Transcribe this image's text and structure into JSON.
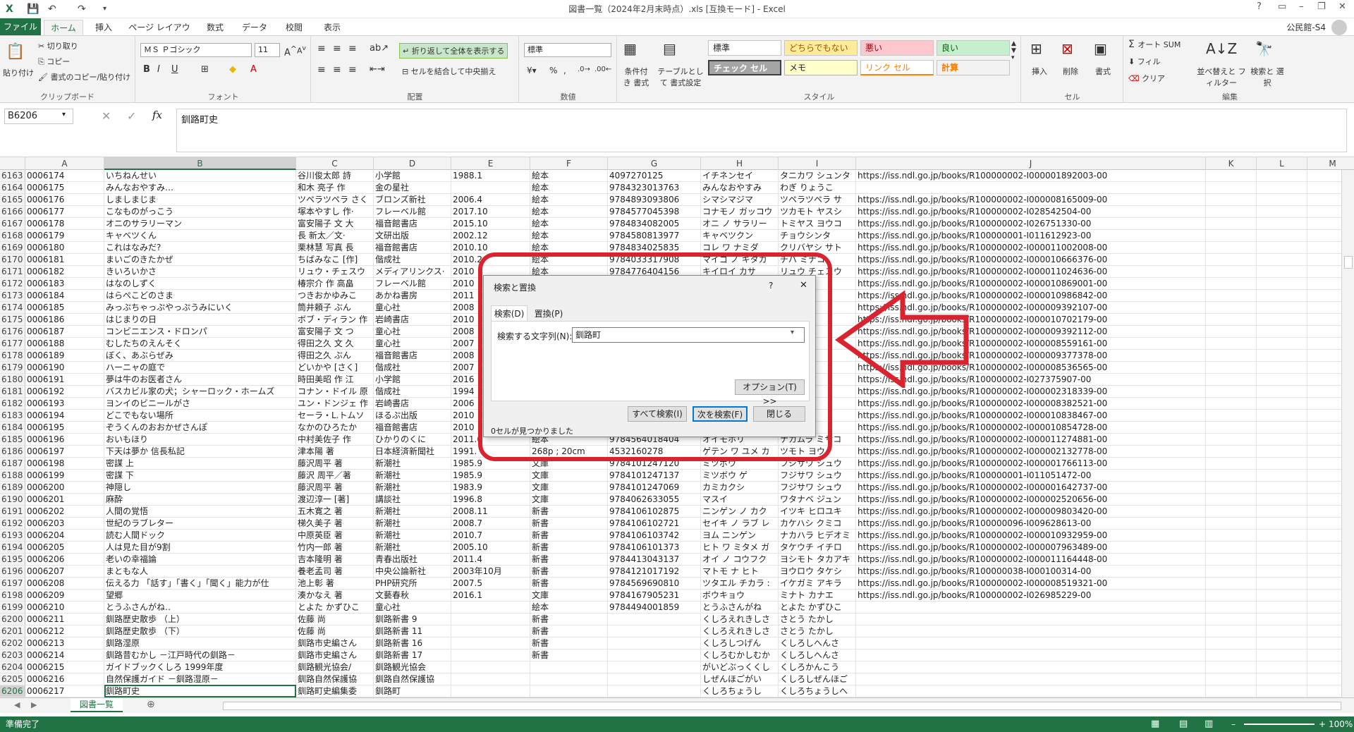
{
  "window": {
    "title": "図書一覧（2024年2月末時点）.xls  [互換モード] - Excel",
    "account": "公民館-S4"
  },
  "tabs": [
    "ファイル",
    "ホーム",
    "挿入",
    "ページ レイアウト",
    "数式",
    "データ",
    "校閲",
    "表示"
  ],
  "ribbon": {
    "clipboard": {
      "paste": "貼り付け",
      "cut": "切り取り",
      "copy": "コピー",
      "format_painter": "書式のコピー/貼り付け",
      "label": "クリップボード"
    },
    "font": {
      "name": "ＭＳ Ｐゴシック",
      "size": "11",
      "label": "フォント"
    },
    "alignment": {
      "wrap": "折り返して全体を表示する",
      "merge": "セルを結合して中央揃え",
      "label": "配置"
    },
    "number": {
      "format": "標準",
      "label": "数値"
    },
    "styles": {
      "conditional": "条件付き 書式",
      "table": "テーブルとして 書式設定",
      "cells": [
        "標準",
        "どちらでもない",
        "悪い",
        "良い",
        "チェック セル",
        "メモ",
        "リンク セル",
        "計算"
      ],
      "label": "スタイル"
    },
    "cells": {
      "insert": "挿入",
      "delete": "削除",
      "format": "書式",
      "label": "セル"
    },
    "editing": {
      "autosum": "オート SUM",
      "fill": "フィル",
      "clear": "クリア",
      "sort": "並べ替えと フィルター",
      "find": "検索と 選択",
      "label": "編集"
    }
  },
  "formula_bar": {
    "name_box": "B6206",
    "formula": "釧路町史",
    "fx": "fx"
  },
  "columns": [
    "A",
    "B",
    "C",
    "D",
    "E",
    "F",
    "G",
    "H",
    "I",
    "J",
    "K",
    "L",
    "M"
  ],
  "rows": [
    [
      "6163",
      "0006174",
      "いちねんせい",
      "谷川俊太郎 詩",
      "小学館",
      "1988.1",
      "絵本",
      "4097270125",
      "イチネンセイ",
      "タニカワ シュンタ",
      "https://iss.ndl.go.jp/books/R100000002-I000001892003-00"
    ],
    [
      "6164",
      "0006175",
      "みんなおやすみ…",
      "和木 亮子 作",
      "金の星社",
      "",
      "絵本",
      "9784323013763",
      "みんなおやすみ",
      "わぎ りょうこ",
      ""
    ],
    [
      "6165",
      "0006176",
      "しましまじま",
      "ツペラツペラ さく",
      "ブロンズ新社",
      "2006.4",
      "絵本",
      "9784893093806",
      "シマシマジマ",
      "ツペラツペラ サ",
      "https://iss.ndl.go.jp/books/R100000002-I000008165009-00"
    ],
    [
      "6166",
      "0006177",
      "こなものがっこう",
      "塚本やすし 作·",
      "フレーベル館",
      "2017.10",
      "絵本",
      "9784577045398",
      "コナモノ ガッコウ",
      "ツカモト ヤスシ",
      "https://iss.ndl.go.jp/books/R100000002-I028542504-00"
    ],
    [
      "6167",
      "0006178",
      "オニのサラリーマン",
      "富安陽子 文 大",
      "福音館書店",
      "2015.10",
      "絵本",
      "9784834082005",
      "オニ ノ サラリー",
      "トミヤス ヨウコ",
      "https://iss.ndl.go.jp/books/R100000002-I026751330-00"
    ],
    [
      "6168",
      "0006179",
      "キャベツくん",
      "長 新太／文·",
      "文研出版",
      "2002.12",
      "絵本",
      "9784580813977",
      "キャベツクン",
      "チョウシンタ",
      "https://iss.ndl.go.jp/books/R100000001-I011612923-00"
    ],
    [
      "6169",
      "0006180",
      "これはなみだ?",
      "栗林慧 写真 長",
      "福音館書店",
      "2010.10",
      "絵本",
      "9784834025835",
      "コレ ワ ナミダ",
      "クリバヤシ サト",
      "https://iss.ndl.go.jp/books/R100000002-I000011002008-00"
    ],
    [
      "6170",
      "0006181",
      "まいごのきたかぜ",
      "ちばみなこ [作]",
      "偕成社",
      "2010.2",
      "絵本",
      "9784033317908",
      "マイゴ ノ キタカ",
      "チバ ミナコ",
      "https://iss.ndl.go.jp/books/R100000002-I000010666376-00"
    ],
    [
      "6171",
      "0006182",
      "きいろいかさ",
      "リュウ・チェスウ",
      "メディアリンクス·",
      "2010",
      "絵本",
      "9784776404156",
      "キイロイ カサ",
      "リュウ チェスウ",
      "https://iss.ndl.go.jp/books/R100000002-I000011024636-00"
    ],
    [
      "6172",
      "0006183",
      "はなのしずく",
      "椿宗介 作 高畠",
      "フレーベル館",
      "2010",
      "",
      "",
      "",
      "",
      "https://iss.ndl.go.jp/books/R100000002-I000010869001-00"
    ],
    [
      "6173",
      "0006184",
      "はらぺこどのさま",
      "つきおかゆみこ",
      "あかね書房",
      "2011",
      "",
      "",
      "",
      "",
      "https://iss.ndl.go.jp/books/R100000002-I000010986842-00"
    ],
    [
      "6174",
      "0006185",
      "みっぷちゃっぷやっぷうみにいく",
      "筒井頼子 ぶん",
      "童心社",
      "2008",
      "",
      "",
      "",
      "",
      "https://iss.ndl.go.jp/books/R100000002-I000009392107-00"
    ],
    [
      "6175",
      "0006186",
      "はじまりの日",
      "ボブ・ディラン 作",
      "岩崎書店",
      "2010",
      "",
      "",
      "",
      "",
      "https://iss.ndl.go.jp/books/R100000002-I000010702179-00"
    ],
    [
      "6176",
      "0006187",
      "コンビニエンス・ドロンパ",
      "富安陽子 文 つ",
      "童心社",
      "2008",
      "",
      "",
      "",
      "",
      "https://iss.ndl.go.jp/books/R100000002-I000009392112-00"
    ],
    [
      "6177",
      "0006188",
      "むしたちのえんそく",
      "得田之久 文 久",
      "童心社",
      "2007",
      "",
      "",
      "",
      "",
      "https://iss.ndl.go.jp/books/R100000002-I000008559161-00"
    ],
    [
      "6178",
      "0006189",
      "ぼく、あぶらぜみ",
      "得田之久 ぶん",
      "福音館書店",
      "2008",
      "",
      "",
      "",
      "",
      "https://iss.ndl.go.jp/books/R100000002-I000009377378-00"
    ],
    [
      "6179",
      "0006190",
      "ハーニャの庭で",
      "どいかや [さく]",
      "偕成社",
      "2007",
      "",
      "",
      "",
      "",
      "https://iss.ndl.go.jp/books/R100000002-I000008536565-00"
    ],
    [
      "6180",
      "0006191",
      "夢は牛のお医者さん",
      "時田美昭 作 江",
      "小学館",
      "2016",
      "",
      "",
      "",
      "",
      "https://iss.ndl.go.jp/books/R100000002-I027375907-00"
    ],
    [
      "6181",
      "0006192",
      "バスカビル家の犬；シャーロック・ホームズ",
      "コナン・ドイル 原",
      "偕成社",
      "1994",
      "",
      "",
      "",
      "",
      "https://iss.ndl.go.jp/books/R100000002-I000002318339-00"
    ],
    [
      "6182",
      "0006193",
      "ヨンイのビニールがさ",
      "ユン・ドンジェ 作",
      "岩崎書店",
      "2006",
      "",
      "",
      "",
      "",
      "https://iss.ndl.go.jp/books/R100000002-I000008382521-00"
    ],
    [
      "6183",
      "0006194",
      "どこでもない場所",
      "セーラ・L.トムソ",
      "ほるぷ出版",
      "2010",
      "",
      "",
      "",
      "",
      "https://iss.ndl.go.jp/books/R100000002-I000010838467-00"
    ],
    [
      "6184",
      "0006195",
      "ぞうくんのおおかぜさんぽ",
      "なかのひろたか",
      "福音館書店",
      "2010",
      "",
      "",
      "",
      "",
      "https://iss.ndl.go.jp/books/R100000002-I000010854728-00"
    ],
    [
      "6185",
      "0006196",
      "おいもほり",
      "中村美佐子 作",
      "ひかりのくに",
      "2011.0",
      "絵本",
      "9784564018404",
      "オイモホリ",
      "ナカムラ ミサコ",
      "https://iss.ndl.go.jp/books/R100000002-I000011274881-00"
    ],
    [
      "6186",
      "0006197",
      "下天は夢か 信長私記",
      "津本陽 著",
      "日本経済新聞社",
      "1991.",
      "268p ; 20cm",
      "4532160278",
      "ゲテン ワ ユメ カ",
      "ツモト ヨウ",
      "https://iss.ndl.go.jp/books/R100000002-I000002132778-00"
    ],
    [
      "6187",
      "0006198",
      "密謀 上",
      "藤沢周平 著",
      "新潮社",
      "1985.9",
      "文庫",
      "9784101247120",
      "ミツボウ",
      "フジサワ シュウ",
      "https://iss.ndl.go.jp/books/R100000002-I000001766113-00"
    ],
    [
      "6188",
      "0006199",
      "密謀 下",
      "藤沢 周平／著",
      "新潮社",
      "1985.9",
      "文庫",
      "9784101247137",
      "ミツボウ ゲ",
      "フジサワ シュウ",
      "https://iss.ndl.go.jp/books/R100000001-I011051472-00"
    ],
    [
      "6189",
      "0006200",
      "神隠し",
      "藤沢周平 著",
      "新潮社",
      "1983.9",
      "文庫",
      "9784101247069",
      "カミカクシ",
      "フジサワ シュウ",
      "https://iss.ndl.go.jp/books/R100000002-I000001642737-00"
    ],
    [
      "6190",
      "0006201",
      "麻酔",
      "渡辺淳一 [著]",
      "講談社",
      "1996.8",
      "文庫",
      "9784062633055",
      "マスイ",
      "ワタナベ ジュン",
      "https://iss.ndl.go.jp/books/R100000002-I000002520656-00"
    ],
    [
      "6191",
      "0006202",
      "人間の覚悟",
      "五木寛之 著",
      "新潮社",
      "2008.11",
      "新書",
      "9784106102875",
      "ニンゲン ノ カク",
      "イツキ ヒロユキ",
      "https://iss.ndl.go.jp/books/R100000002-I000009803420-00"
    ],
    [
      "6192",
      "0006203",
      "世紀のラブレター",
      "梯久美子 著",
      "新潮社",
      "2008.7",
      "新書",
      "9784106102721",
      "セイキ ノ ラブ レ",
      "カケハシ クミコ",
      "https://iss.ndl.go.jp/books/R100000096-I009628613-00"
    ],
    [
      "6193",
      "0006204",
      "読む人間ドック",
      "中原英臣 著",
      "新潮社",
      "2010.7",
      "新書",
      "9784106103742",
      "ヨム ニンゲン",
      "ナカハラ ヒデオミ",
      "https://iss.ndl.go.jp/books/R100000002-I000010932959-00"
    ],
    [
      "6194",
      "0006205",
      "人は見た目が9割",
      "竹内一郎 著",
      "新潮社",
      "2005.10",
      "新書",
      "9784106101373",
      "ヒト ワ ミタメ ガ",
      "タケウチ イチロ",
      "https://iss.ndl.go.jp/books/R100000002-I000007963489-00"
    ],
    [
      "6195",
      "0006206",
      "老いの幸福論",
      "吉本隆明 著",
      "青春出版社",
      "2011.4",
      "新書",
      "9784413043137",
      "オイ ノ コウフク",
      "ヨシモト タカアキ",
      "https://iss.ndl.go.jp/books/R100000002-I000011164448-00"
    ],
    [
      "6196",
      "0006207",
      "まともな人",
      "養老孟司 著",
      "中央公論新社",
      "2003年10月",
      "新書",
      "9784121017192",
      "マトモ ナ ヒト",
      "ヨウロウ タケシ",
      "https://iss.ndl.go.jp/books/R100000038-I000100314-00"
    ],
    [
      "6197",
      "0006208",
      "伝える力 「話す」「書く」「聞く」能力が仕",
      "池上彰 著",
      "PHP研究所",
      "2007.5",
      "新書",
      "9784569690810",
      "ツタエル チカラ :",
      "イケガミ アキラ",
      "https://iss.ndl.go.jp/books/R100000002-I000008519321-00"
    ],
    [
      "6198",
      "0006209",
      "望郷",
      "湊かなえ 著",
      "文藝春秋",
      "2016.1",
      "文庫",
      "9784167905231",
      "ボウキョウ",
      "ミナト カナエ",
      "https://iss.ndl.go.jp/books/R100000002-I026985229-00"
    ],
    [
      "6199",
      "0006210",
      "とうふさんがね‥",
      "とよた かずひこ",
      "童心社",
      "",
      "絵本",
      "9784494001859",
      "とうふさんがね",
      "とよた かずひこ",
      ""
    ],
    [
      "6200",
      "0006211",
      "釧路歴史散歩 （上）",
      "佐藤 尚",
      "釧路新書 9",
      "",
      "新書",
      "",
      "くしろえれきしさ",
      "さとう たかし",
      ""
    ],
    [
      "6201",
      "0006212",
      "釧路歴史散歩 （下）",
      "佐藤 尚",
      "釧路新書 11",
      "",
      "新書",
      "",
      "くしろえれきしさ",
      "さとう たかし",
      ""
    ],
    [
      "6202",
      "0006213",
      "釧路湿原",
      "釧路市史編さん",
      "釧路新書 16",
      "",
      "新書",
      "",
      "くしろしつげん",
      "くしろしへんさ",
      ""
    ],
    [
      "6203",
      "0006214",
      "釧路昔むかし －江戸時代の釧路－",
      "釧路市史編さん",
      "釧路新書 17",
      "",
      "新書",
      "",
      "くしろむかしむか",
      "くしろしへんさ",
      ""
    ],
    [
      "6204",
      "0006215",
      "ガイドブックくしろ 1999年度",
      "釧路観光協会/",
      "釧路観光協会",
      "",
      "",
      "",
      "がいどぶっくくし",
      "くしろかんこう",
      ""
    ],
    [
      "6205",
      "0006216",
      "自然保護ガイド －釧路湿原－",
      "釧路自然保護協",
      "釧路自然保護協",
      "",
      "",
      "",
      "しぜんほごがい",
      "くしろしぜんほご",
      ""
    ],
    [
      "6206",
      "0006217",
      "釧路町史",
      "釧路町史編集委",
      "釧路町",
      "",
      "",
      "",
      "くしろちょうし",
      "くしろちょうしへ",
      ""
    ]
  ],
  "sheet": {
    "tab": "図書一覧"
  },
  "status": {
    "ready": "準備完了",
    "zoom": "100%"
  },
  "dialog": {
    "title": "検索と置換",
    "help": "?",
    "close": "✕",
    "tab_search": "検索(D)",
    "tab_replace": "置換(P)",
    "field_label": "検索する文字列(N):",
    "field_value": "釧路町",
    "options_btn": "オプション(T) >>",
    "find_all": "すべて検索(I)",
    "find_next": "次を検索(F)",
    "close_btn": "閉じる",
    "status": "0セルが見つかりました"
  },
  "colors": {
    "excel_green": "#217346",
    "annotation_red": "#d9242f"
  }
}
